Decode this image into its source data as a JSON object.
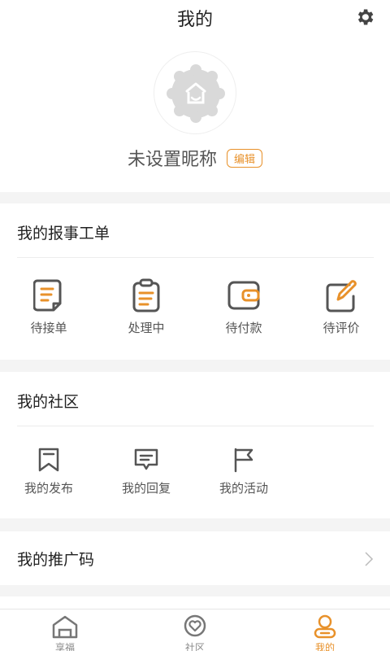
{
  "header": {
    "title": "我的",
    "nickname": "未设置昵称",
    "edit_label": "编辑"
  },
  "orders": {
    "title": "我的报事工单",
    "items": [
      {
        "label": "待接单",
        "icon": "document-icon"
      },
      {
        "label": "处理中",
        "icon": "clipboard-icon"
      },
      {
        "label": "待付款",
        "icon": "wallet-icon"
      },
      {
        "label": "待评价",
        "icon": "edit-icon"
      }
    ]
  },
  "community": {
    "title": "我的社区",
    "items": [
      {
        "label": "我的发布",
        "icon": "bookmark-icon"
      },
      {
        "label": "我的回复",
        "icon": "message-icon"
      },
      {
        "label": "我的活动",
        "icon": "flag-icon"
      }
    ]
  },
  "promo": {
    "title": "我的推广码"
  },
  "tabbar": {
    "tabs": [
      {
        "label": "享福",
        "icon": "home-icon"
      },
      {
        "label": "社区",
        "icon": "heart-chat-icon"
      },
      {
        "label": "我的",
        "icon": "user-icon",
        "active": true
      }
    ]
  },
  "colors": {
    "accent": "#e8912a",
    "icon_dark": "#555555"
  }
}
